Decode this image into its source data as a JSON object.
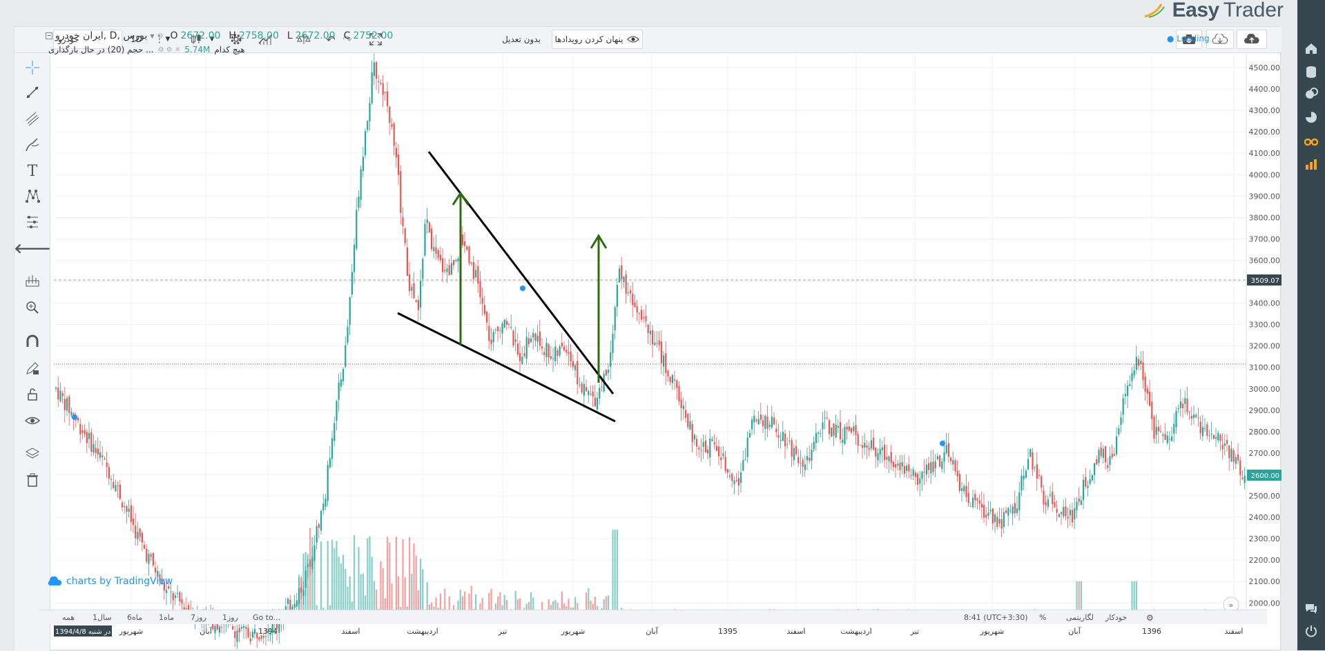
{
  "brand": {
    "name_bold": "Easy",
    "name_light": "Trader"
  },
  "toolbar": {
    "symbol": "خودرو",
    "interval": "1D",
    "adjust": "بدون تعدیل",
    "hide_events": "پنهان کردن رویدادها"
  },
  "legend": {
    "title": "ایران خودرو, D, بورس",
    "o_label": "O",
    "o_value": "2672.00",
    "h_label": "H",
    "h_value": "2758.00",
    "l_label": "L",
    "l_value": "2672.00",
    "c_label": "C",
    "c_value": "2752.00",
    "volume_label": "حجم (20) در حال بارگذاری ...",
    "volume_value": "5.74M",
    "volume_extra": "هیچ کدام"
  },
  "loading": "Loading",
  "price_axis": {
    "ticks": [
      "4500.00",
      "4400.00",
      "4300.00",
      "4200.00",
      "4100.00",
      "4000.00",
      "3900.00",
      "3800.00",
      "3700.00",
      "3600.00",
      "3500.00",
      "3400.00",
      "3300.00",
      "3200.00",
      "3100.00",
      "3000.00",
      "2900.00",
      "2800.00",
      "2700.00",
      "2600.00",
      "2500.00",
      "2400.00",
      "2300.00",
      "2200.00",
      "2100.00",
      "2000.00"
    ],
    "dashed_level": "3509.07",
    "last_price": "2600.00"
  },
  "time_axis": {
    "cursor_label": "1394/4/8 در شنبه",
    "labels": [
      "شهریور",
      "آبان",
      "1394",
      "اسفند",
      "اردیبهشت",
      "تیر",
      "شهریور",
      "آبان",
      "1395",
      "اسفند",
      "اردیبهشت",
      "تیر",
      "شهریور",
      "آبان",
      "1396",
      "اسفند"
    ]
  },
  "tradingview": "charts by TradingView",
  "bottom": {
    "ranges": [
      "همه",
      "1سال",
      "6ماه",
      "1ماه",
      "7روز",
      "1روز"
    ],
    "goto": "Go to...",
    "time": "8:41 (UTC+3:30)",
    "percent": "%",
    "log": "لگاریتمی",
    "auto": "خودکار"
  },
  "colors": {
    "up": "#26a69a",
    "down": "#ef5350",
    "accent": "#2196f3",
    "sidebar": "#37474f"
  }
}
